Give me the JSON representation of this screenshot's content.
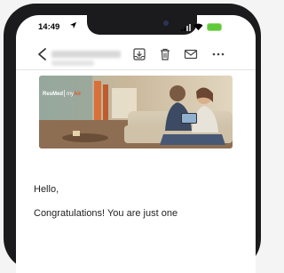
{
  "status_bar": {
    "time": "14:49",
    "battery_color": "#5fcb3a"
  },
  "toolbar": {
    "icons": [
      "back-chevron-icon",
      "save-to-inbox-icon",
      "trash-icon",
      "mail-icon",
      "more-icon"
    ]
  },
  "hero_image": {
    "brand_logo_text": "ResMed | myAir",
    "accent_color": "#e05a2b"
  },
  "email": {
    "greeting": "Hello,",
    "body_first_line": "Congratulations! You are just one"
  }
}
